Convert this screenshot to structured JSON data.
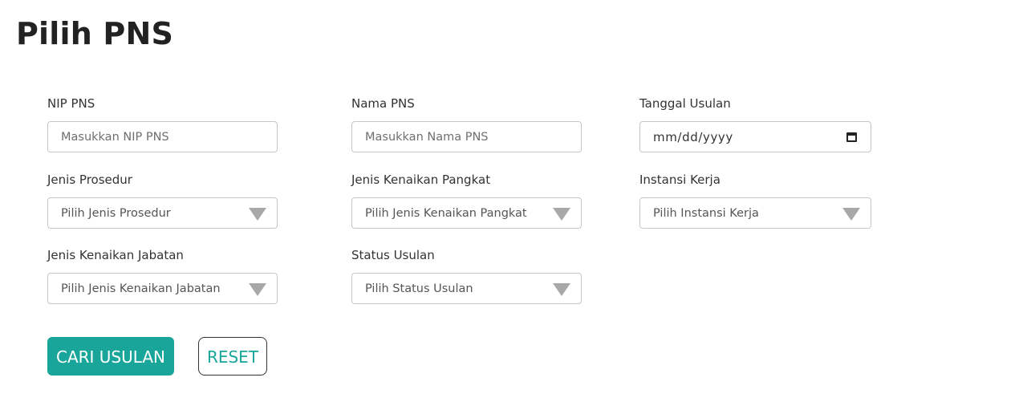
{
  "page": {
    "title": "Pilih PNS"
  },
  "form": {
    "nip": {
      "label": "NIP PNS",
      "placeholder": "Masukkan NIP PNS"
    },
    "nama": {
      "label": "Nama PNS",
      "placeholder": "Masukkan Nama PNS"
    },
    "tanggal": {
      "label": "Tanggal Usulan",
      "value": "mm/dd/yyyy",
      "icon": "calendar-icon"
    },
    "jenis_prosedur": {
      "label": "Jenis Prosedur",
      "selected": "Pilih Jenis Prosedur"
    },
    "jenis_kenaikan_pangkat": {
      "label": "Jenis Kenaikan Pangkat",
      "selected": "Pilih Jenis Kenaikan Pangkat"
    },
    "instansi_kerja": {
      "label": "Instansi Kerja",
      "selected": "Pilih Instansi Kerja"
    },
    "jenis_kenaikan_jabatan": {
      "label": "Jenis Kenaikan Jabatan",
      "selected": "Pilih Jenis Kenaikan Jabatan"
    },
    "status_usulan": {
      "label": "Status Usulan",
      "selected": "Pilih Status Usulan"
    }
  },
  "actions": {
    "search_label": "CARI USULAN",
    "reset_label": "RESET"
  },
  "colors": {
    "accent": "#1aa59b",
    "border": "#c6c6c6",
    "arrow": "#a8a8a8"
  }
}
